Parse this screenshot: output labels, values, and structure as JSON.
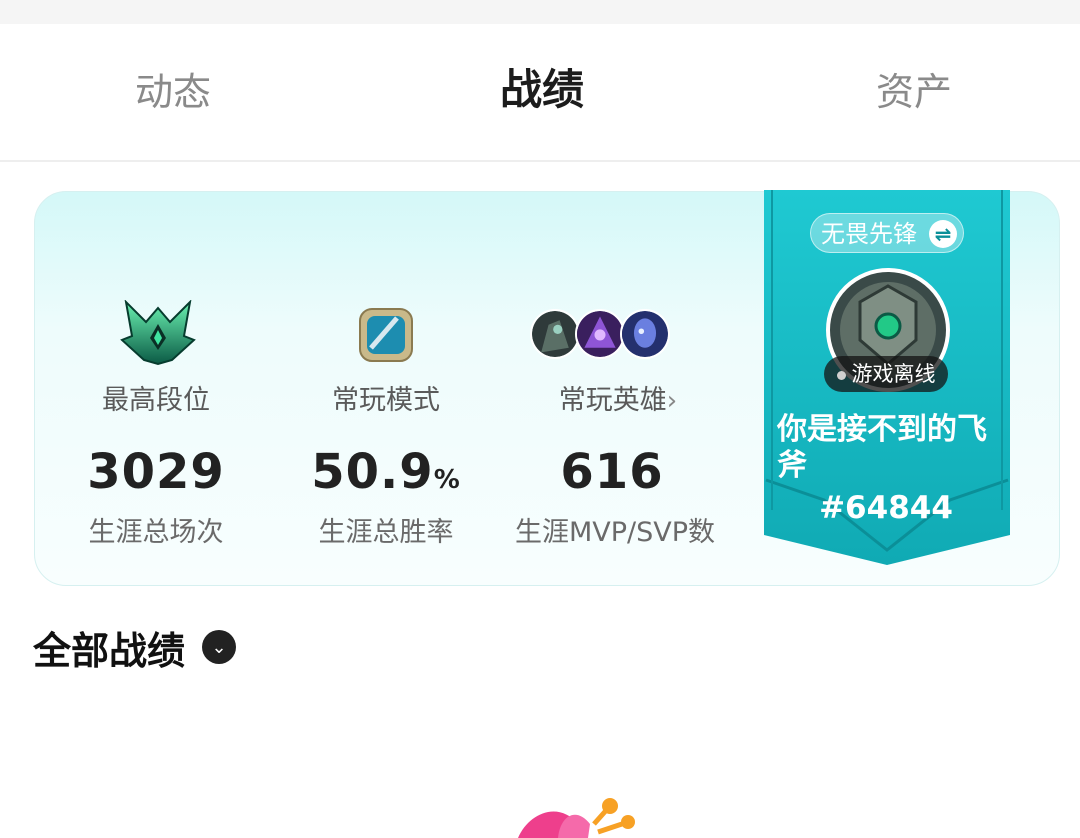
{
  "tabs": [
    {
      "label": "动态",
      "active": false
    },
    {
      "label": "战绩",
      "active": true
    },
    {
      "label": "资产",
      "active": false
    }
  ],
  "stats_card": {
    "highest_rank_label": "最高段位",
    "common_mode_label": "常玩模式",
    "common_heroes_label": "常玩英雄",
    "total_games": {
      "value": "3029",
      "caption": "生涯总场次"
    },
    "win_rate": {
      "value": "50.9",
      "unit": "%",
      "caption": "生涯总胜率"
    },
    "mvp_svp": {
      "value": "616",
      "caption": "生涯MVP/SVP数"
    }
  },
  "profile": {
    "server": "无畏先锋",
    "status": "游戏离线",
    "nickname": "你是接不到的飞斧",
    "id": "#64844"
  },
  "section": {
    "title": "全部战绩"
  },
  "colors": {
    "accent_teal": "#14b9c4",
    "card_bg": "#e4fbfb"
  },
  "icons": [
    "rank-emblem-icon",
    "game-mode-icon",
    "hero-avatar-icon",
    "swap-icon",
    "chevron-right-icon",
    "chevron-down-icon"
  ]
}
